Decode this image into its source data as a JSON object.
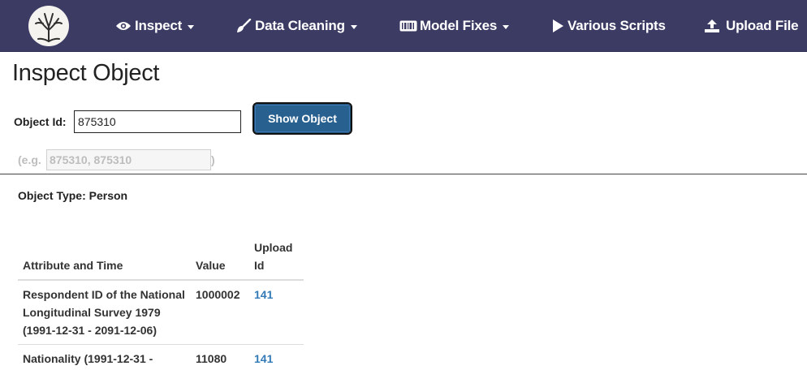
{
  "navbar": {
    "logo_icon": "tree-logo",
    "items": [
      {
        "label": "Inspect",
        "icon": "eye-icon",
        "dropdown": true
      },
      {
        "label": "Data Cleaning",
        "icon": "brush-icon",
        "dropdown": true
      },
      {
        "label": "Model Fixes",
        "icon": "barcode-icon",
        "dropdown": true
      },
      {
        "label": "Various Scripts",
        "icon": "play-icon",
        "dropdown": false
      },
      {
        "label": "Upload File",
        "icon": "upload-icon",
        "dropdown": false
      }
    ],
    "background_color": "#3c3b64"
  },
  "page": {
    "title": "Inspect Object",
    "object_id_label": "Object Id:",
    "object_id_value": "875310",
    "show_button_label": "Show Object",
    "example_open": "(e.g.",
    "example_value": "875310, 875310",
    "example_close": ")",
    "object_type": "Object Type: Person"
  },
  "table": {
    "headers": [
      "Attribute and Time",
      "Value",
      "Upload Id"
    ],
    "rows": [
      {
        "attribute": "Respondent ID of the National Longitudinal Survey 1979 (1991-12-31 - 2091-12-06)",
        "value": "1000002",
        "upload_id": "141"
      },
      {
        "attribute": "Nationality (1991-12-31 -",
        "value": "11080",
        "upload_id": "141"
      }
    ]
  },
  "colors": {
    "button": "#286090",
    "link": "#337ab7"
  }
}
